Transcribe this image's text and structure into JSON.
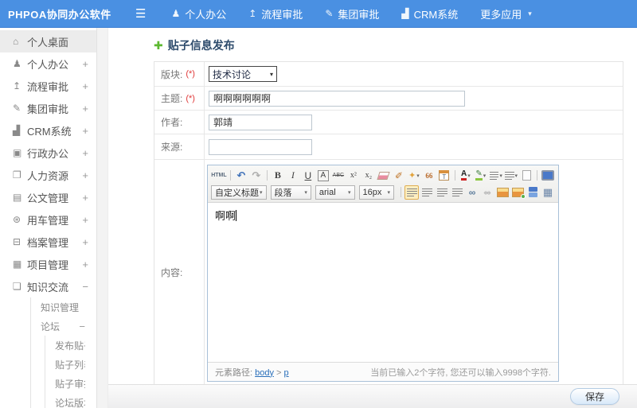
{
  "navbar": {
    "logo": "PHPOA协同办公软件",
    "items": [
      {
        "label": "个人办公"
      },
      {
        "label": "流程审批"
      },
      {
        "label": "集团审批"
      },
      {
        "label": "CRM系统"
      },
      {
        "label": "更多应用"
      }
    ]
  },
  "sidebar": {
    "items": [
      {
        "label": "个人桌面"
      },
      {
        "label": "个人办公",
        "expander": "+"
      },
      {
        "label": "流程审批",
        "expander": "+"
      },
      {
        "label": "集团审批",
        "expander": "+"
      },
      {
        "label": "CRM系统",
        "expander": "+"
      },
      {
        "label": "行政办公",
        "expander": "+"
      },
      {
        "label": "人力资源",
        "expander": "+"
      },
      {
        "label": "公文管理",
        "expander": "+"
      },
      {
        "label": "用车管理",
        "expander": "+"
      },
      {
        "label": "档案管理",
        "expander": "+"
      },
      {
        "label": "项目管理",
        "expander": "+"
      },
      {
        "label": "知识交流",
        "expander": "−"
      }
    ],
    "sub_items": [
      {
        "label": "知识管理"
      },
      {
        "label": "论坛",
        "expander": "−"
      }
    ],
    "sub_sub_items": [
      {
        "label": "发布贴子"
      },
      {
        "label": "贴子列表"
      },
      {
        "label": "贴子审批"
      },
      {
        "label": "论坛版块设置"
      }
    ]
  },
  "page": {
    "title": "贴子信息发布"
  },
  "form": {
    "required_mark": "(*)",
    "board_label": "版块:",
    "board_value": "技术讨论",
    "subject_label": "主题:",
    "subject_value": "啊啊啊啊啊啊",
    "author_label": "作者:",
    "author_value": "郭靖",
    "source_label": "来源:",
    "source_value": "",
    "content_label": "内容:"
  },
  "editor": {
    "selects": {
      "style": "自定义标题",
      "paragraph": "段落",
      "font": "arial",
      "size": "16px"
    },
    "content": "啊啊",
    "status": {
      "path_label": "元素路径: ",
      "path_body": "body",
      "path_sep": " > ",
      "path_p": "p",
      "counter": "当前已输入2个字符, 您还可以输入9998个字符."
    }
  },
  "footer": {
    "save": "保存"
  },
  "icons": {
    "menu": "☰",
    "caret": "▾",
    "home": "⌂",
    "person": "♟",
    "flow": "↥",
    "edit": "✎",
    "chart": "▟",
    "briefcase": "▣",
    "book": "❐",
    "doc": "▤",
    "car": "⊛",
    "archive": "⊟",
    "project": "▦",
    "chat": "❏",
    "plus": "✚",
    "html": "HTML",
    "undo": "↶",
    "redo": "↷",
    "bold": "B",
    "italic": "I",
    "underline": "U",
    "fontborder": "A",
    "strike": "ABC",
    "sup": "x²",
    "sub": "x₂",
    "brush": "✐",
    "wand": "✦",
    "quote": "66",
    "date": "T",
    "forecolor": "A",
    "hilite": "✎",
    "link": "∞",
    "unlink": "∞",
    "table": "▦"
  },
  "colors": {
    "navbar_blue": "#4a90e2",
    "accent_green": "#5db831",
    "required_red": "#e03a3a",
    "link_blue": "#2a6fba"
  }
}
